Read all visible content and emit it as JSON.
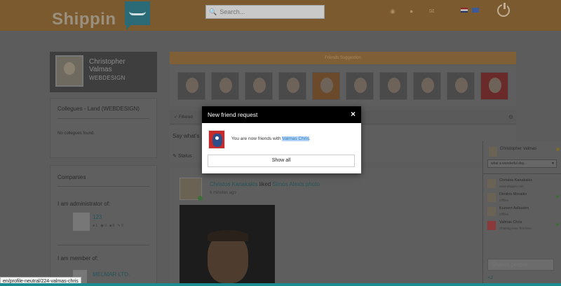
{
  "header": {
    "brand": "Shippin",
    "search_placeholder": "Search..."
  },
  "profile": {
    "name": "Christopher Valmas",
    "company": "WEBDESIGN"
  },
  "colleagues": {
    "title": "Collegues - Land (WEBDESIGN)",
    "empty_text": "No collegues found."
  },
  "companies": {
    "title": "Companies",
    "admin_label": "I am administrator of:",
    "admin_company": {
      "name": "123",
      "stats": [
        "1",
        "0",
        "0",
        "0"
      ]
    },
    "member_label": "I am member of:",
    "member_company": {
      "name": "MELMAR LTD."
    }
  },
  "suggestions": {
    "title": "Friends Suggestion",
    "count": 10
  },
  "filter": {
    "label": "Filtered"
  },
  "status_box": {
    "prompt": "Say what's",
    "tab": "Status"
  },
  "feed": {
    "actor": "Christos Kanakakis",
    "verb": "liked",
    "object": "Simos Alexis photo",
    "time": "6 minutes ago"
  },
  "modal": {
    "title": "New friend request",
    "message_prefix": "You are now friends with",
    "friend_name": "Valmas Chris",
    "message_suffix": ".",
    "button": "Show all",
    "close": "×"
  },
  "chat": {
    "me_name": "Christopher Valmas",
    "status_text": "what a wonderful day...",
    "contacts": [
      {
        "name": "Christos Kanakakis",
        "status": "www.shippin.com"
      },
      {
        "name": "Dimitris Moraitis",
        "status": "Offline"
      },
      {
        "name": "Kuzeen Aslkasim",
        "status": "Offline"
      },
      {
        "name": "Valmas Chris",
        "status": "Chatting now: first time"
      }
    ],
    "search_placeholder": "Search people",
    "plus": "+2"
  },
  "status_url": "en/profile-neutral/224-valmas-chris",
  "colors": {
    "topbar": "#7a5a2e",
    "accent_teal": "#26545a",
    "modal_head": "#000000",
    "highlight": "#b3d4fc"
  }
}
